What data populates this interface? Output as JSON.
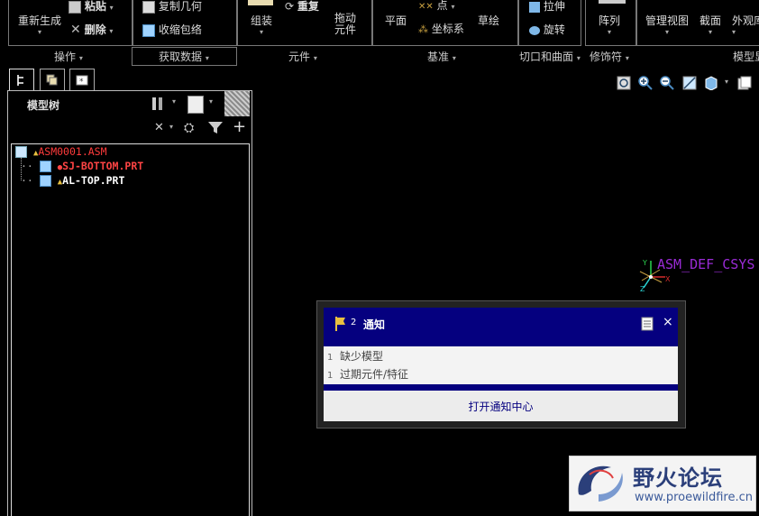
{
  "ribbon": {
    "groups": {
      "operations": "操作",
      "get_data": "获取数据",
      "components": "元件",
      "datum": "基准",
      "cut_surface": "切口和曲面",
      "modifiers": "修饰符",
      "model_display": "模型显"
    },
    "buttons": {
      "regenerate": "重新生成",
      "paste": "粘贴",
      "delete": "删除",
      "copy_geometry": "复制几何",
      "shrinkwrap": "收缩包络",
      "assemble": "组装",
      "repeat": "重复",
      "drag_components_1": "拖动",
      "drag_components_2": "元件",
      "plane": "平面",
      "point": "点",
      "csys": "坐标系",
      "sketch": "草绘",
      "extrude": "拉伸",
      "revolve": "旋转",
      "pattern": "阵列",
      "manage_views": "管理视图",
      "section": "截面",
      "appearance": "外观库"
    }
  },
  "model_tree": {
    "title": "模型树",
    "items": [
      {
        "name": "ASM0001.ASM",
        "color": "#ff3b3b"
      },
      {
        "name": "SJ-BOTTOM.PRT",
        "color": "#ff4444"
      },
      {
        "name": "AL-TOP.PRT",
        "color": "#ffffff"
      }
    ]
  },
  "viewport": {
    "csys_label": "ASM_DEF_CSYS",
    "axis_x": "X",
    "axis_y": "Y",
    "axis_z": "Z"
  },
  "notification": {
    "title": "通知",
    "items": [
      {
        "count": "1",
        "text": "缺少模型"
      },
      {
        "count": "1",
        "text": "过期元件/特征"
      }
    ],
    "open_center": "打开通知中心"
  },
  "watermark": {
    "name": "野火论坛",
    "url": "www.proewildfire.cn"
  },
  "colors": {
    "dialog_header": "#05007f",
    "tree_error": "#ff3b3b",
    "csys": "#9a2bd6"
  }
}
